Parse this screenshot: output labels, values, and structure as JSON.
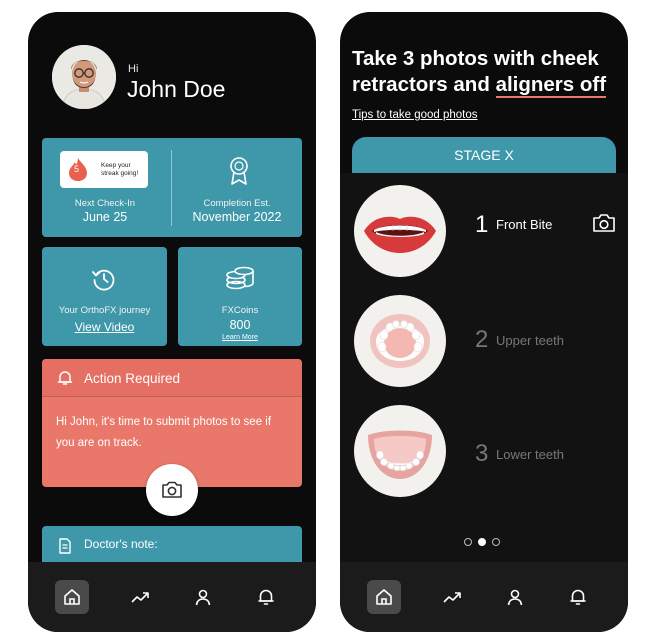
{
  "left_screen": {
    "greeting": {
      "hi": "Hi",
      "name": "John Doe"
    },
    "streak": {
      "count": "5",
      "text": "Keep your streak going!"
    },
    "next_checkin": {
      "label": "Next Check-In",
      "value": "June 25"
    },
    "completion": {
      "label": "Completion Est.",
      "value": "November 2022"
    },
    "journey": {
      "label": "Your OrthoFX journey",
      "link": "View Video"
    },
    "coins": {
      "label": "FXCoins",
      "value": "800",
      "link": "Learn More"
    },
    "action": {
      "title": "Action Required",
      "body": "Hi John, it's time to submit photos to see if you are on track."
    },
    "doctor_note": {
      "title": "Doctor's note:"
    }
  },
  "right_screen": {
    "title_line1": "Take 3 photos with cheek",
    "title_line2_a": "retractors and ",
    "title_line2_b": "aligners off",
    "tips_link": "Tips to take good photos",
    "stage": "STAGE X",
    "steps": [
      {
        "number": "1",
        "label": "Front Bite"
      },
      {
        "number": "2",
        "label": "Upper teeth"
      },
      {
        "number": "3",
        "label": "Lower teeth"
      }
    ],
    "pager": {
      "pages": 3,
      "current": 2
    }
  },
  "colors": {
    "accent_teal": "#3e98aa",
    "alert_coral": "#e9786b",
    "background": "#0b0b0b"
  },
  "nav_icons": [
    "home-icon",
    "trend-icon",
    "profile-icon",
    "bell-icon"
  ]
}
